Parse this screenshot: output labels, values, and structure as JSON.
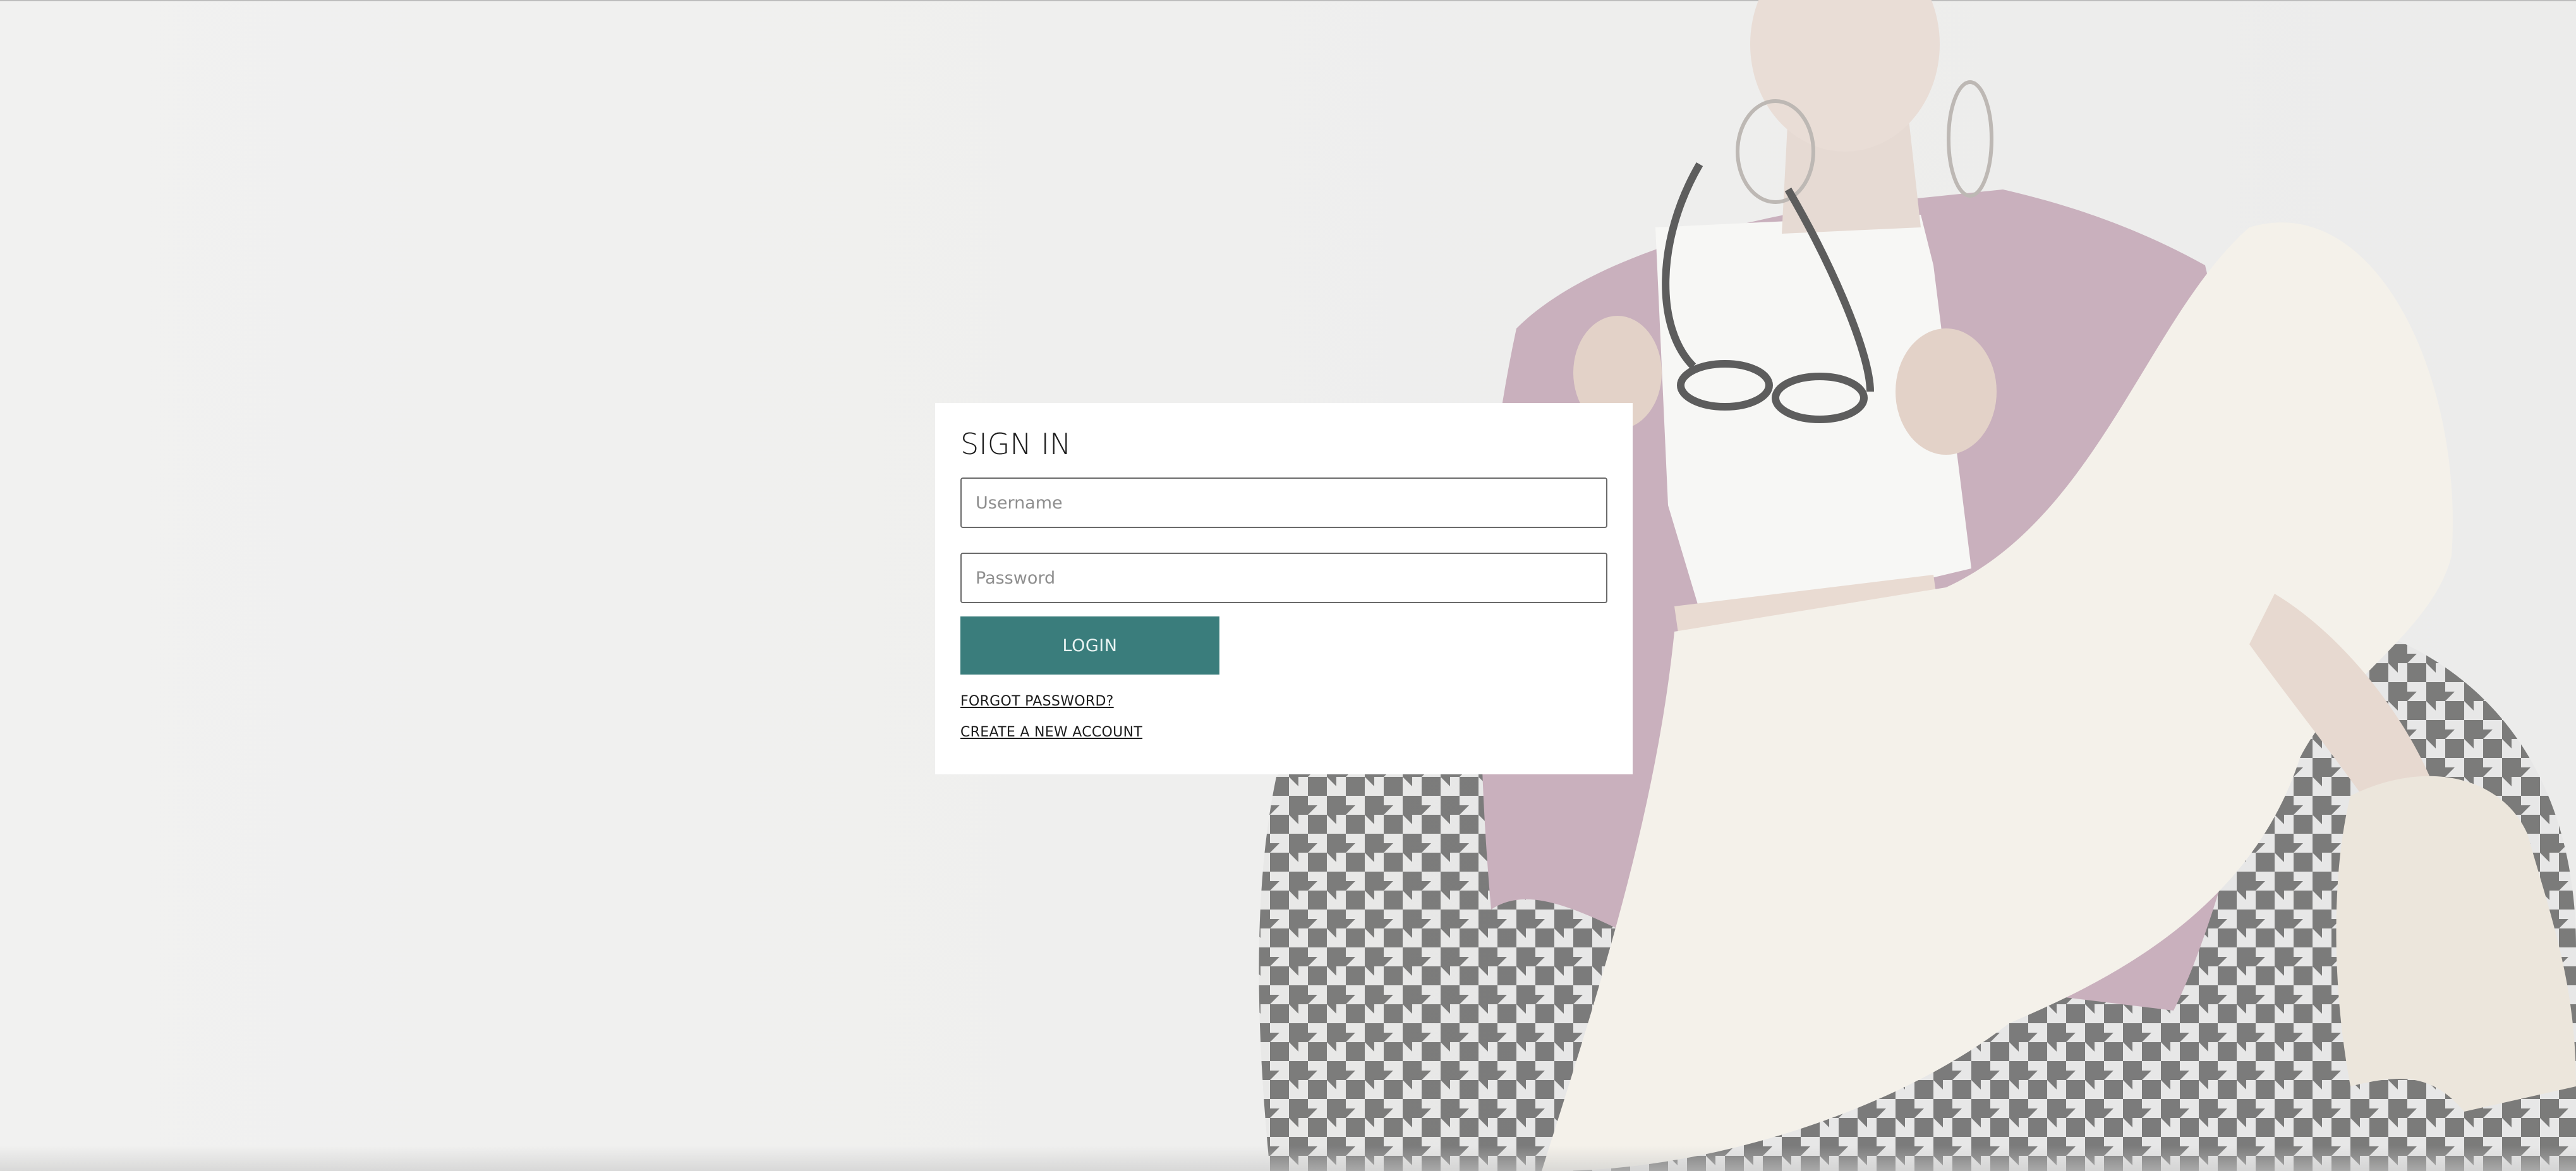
{
  "signin": {
    "title": "SIGN IN",
    "username_placeholder": "Username",
    "password_placeholder": "Password",
    "login_label": "LOGIN",
    "forgot_label": "FORGOT PASSWORD?",
    "create_label": "CREATE A NEW ACCOUNT"
  },
  "colors": {
    "accent": "#3a7d7c",
    "page_background": "#efefee",
    "card_background": "#ffffff",
    "text": "#1c1c1c"
  }
}
